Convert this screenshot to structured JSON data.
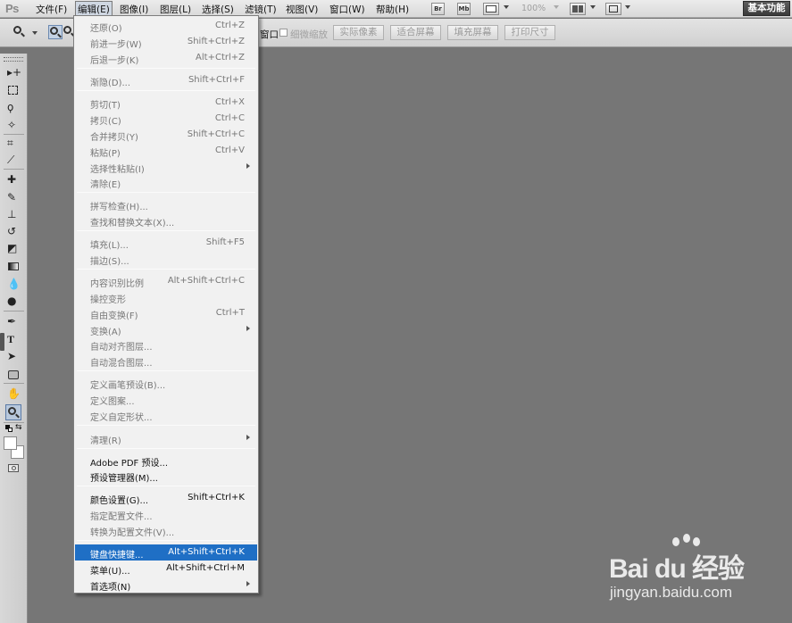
{
  "app": {
    "logo": "Ps"
  },
  "menubar": {
    "items": [
      "文件(F)",
      "编辑(E)",
      "图像(I)",
      "图层(L)",
      "选择(S)",
      "滤镜(T)",
      "视图(V)",
      "窗口(W)",
      "帮助(H)"
    ],
    "active_item": "编辑(E)",
    "icons": {
      "bridge": "Br",
      "mini_bridge": "Mb"
    },
    "zoom_level": "100%",
    "workspace_label": "基本功能"
  },
  "options_bar": {
    "window_resize_tail": "窗口",
    "scrubby_zoom_label": "细微缩放",
    "buttons": [
      "实际像素",
      "适合屏幕",
      "填充屏幕",
      "打印尺寸"
    ]
  },
  "toolbox": {
    "tools": [
      "move-tool",
      "marquee-tool",
      "lasso-tool",
      "quick-selection-tool",
      "crop-tool",
      "eyedropper-tool",
      "spot-healing-tool",
      "brush-tool",
      "clone-stamp-tool",
      "history-brush-tool",
      "eraser-tool",
      "gradient-tool",
      "blur-tool",
      "dodge-tool",
      "pen-tool",
      "type-tool",
      "path-selection-tool",
      "shape-tool",
      "hand-tool",
      "zoom-tool"
    ],
    "selected_tool": "zoom-tool"
  },
  "edit_menu": {
    "items": [
      {
        "label": "还原(O)",
        "shortcut": "Ctrl+Z",
        "enabled": false
      },
      {
        "label": "前进一步(W)",
        "shortcut": "Shift+Ctrl+Z",
        "enabled": false
      },
      {
        "label": "后退一步(K)",
        "shortcut": "Alt+Ctrl+Z",
        "enabled": false
      },
      {
        "label": "渐隐(D)...",
        "shortcut": "Shift+Ctrl+F",
        "enabled": false
      },
      {
        "label": "剪切(T)",
        "shortcut": "Ctrl+X",
        "enabled": false
      },
      {
        "label": "拷贝(C)",
        "shortcut": "Ctrl+C",
        "enabled": false
      },
      {
        "label": "合并拷贝(Y)",
        "shortcut": "Shift+Ctrl+C",
        "enabled": false
      },
      {
        "label": "粘贴(P)",
        "shortcut": "Ctrl+V",
        "enabled": false
      },
      {
        "label": "选择性粘贴(I)",
        "shortcut": "",
        "enabled": false
      },
      {
        "label": "清除(E)",
        "shortcut": "",
        "enabled": false
      },
      {
        "label": "拼写检查(H)...",
        "shortcut": "",
        "enabled": false
      },
      {
        "label": "查找和替换文本(X)...",
        "shortcut": "",
        "enabled": false
      },
      {
        "label": "填充(L)...",
        "shortcut": "Shift+F5",
        "enabled": false
      },
      {
        "label": "描边(S)...",
        "shortcut": "",
        "enabled": false
      },
      {
        "label": "内容识别比例",
        "shortcut": "Alt+Shift+Ctrl+C",
        "enabled": false
      },
      {
        "label": "操控变形",
        "shortcut": "",
        "enabled": false
      },
      {
        "label": "自由变换(F)",
        "shortcut": "Ctrl+T",
        "enabled": false
      },
      {
        "label": "变换(A)",
        "shortcut": "",
        "enabled": false
      },
      {
        "label": "自动对齐图层...",
        "shortcut": "",
        "enabled": false
      },
      {
        "label": "自动混合图层...",
        "shortcut": "",
        "enabled": false
      },
      {
        "label": "定义画笔预设(B)...",
        "shortcut": "",
        "enabled": false
      },
      {
        "label": "定义图案...",
        "shortcut": "",
        "enabled": false
      },
      {
        "label": "定义自定形状...",
        "shortcut": "",
        "enabled": false
      },
      {
        "label": "清理(R)",
        "shortcut": "",
        "enabled": false
      },
      {
        "label": "Adobe PDF 预设...",
        "shortcut": "",
        "enabled": true
      },
      {
        "label": "预设管理器(M)...",
        "shortcut": "",
        "enabled": true
      },
      {
        "label": "颜色设置(G)...",
        "shortcut": "Shift+Ctrl+K",
        "enabled": true
      },
      {
        "label": "指定配置文件...",
        "shortcut": "",
        "enabled": false
      },
      {
        "label": "转换为配置文件(V)...",
        "shortcut": "",
        "enabled": false
      },
      {
        "label": "键盘快捷键...",
        "shortcut": "Alt+Shift+Ctrl+K",
        "enabled": true,
        "highlighted": true
      },
      {
        "label": "菜单(U)...",
        "shortcut": "Alt+Shift+Ctrl+M",
        "enabled": true
      },
      {
        "label": "首选项(N)",
        "shortcut": "",
        "enabled": true
      }
    ]
  },
  "watermark": {
    "logo": "Bai du 经验",
    "url": "jingyan.baidu.com"
  }
}
